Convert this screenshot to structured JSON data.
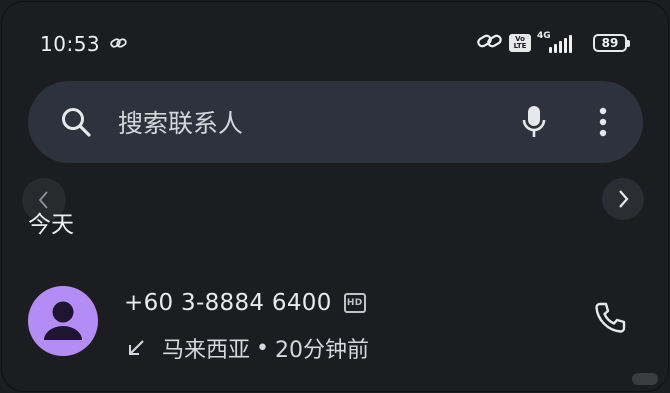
{
  "status_bar": {
    "time": "10:53",
    "network": "4G",
    "volte": [
      "Vo",
      "LTE"
    ],
    "battery": "89"
  },
  "search": {
    "placeholder": "搜索联系人",
    "icons": [
      "search-icon",
      "mic-icon",
      "more-vert-icon"
    ]
  },
  "section": {
    "title": "今天"
  },
  "call_log": [
    {
      "number": "+60 3-8884 6400",
      "hd_badge": "HD",
      "direction": "incoming",
      "location": "马来西亚",
      "separator": "•",
      "time_ago": "20分钟前"
    }
  ],
  "colors": {
    "background": "#1b1d21",
    "search_bar": "#2d323c",
    "avatar": "#b48cf6"
  }
}
